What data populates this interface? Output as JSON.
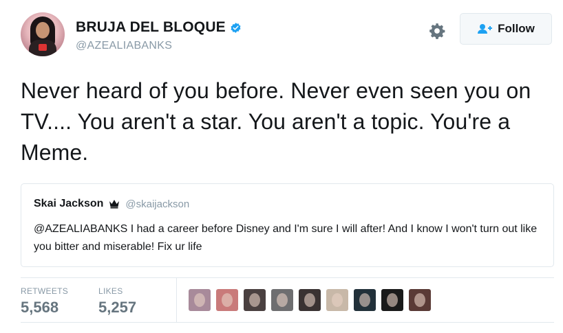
{
  "profile": {
    "display_name": "BRUJA DEL BLOQUE",
    "handle": "@AZEALIABANKS",
    "verified": true
  },
  "actions": {
    "settings_icon": "gear-icon",
    "follow_label": "Follow",
    "follow_icon": "add-user-icon"
  },
  "tweet": {
    "text": "Never heard of you before. Never even seen you on TV.... You aren't a star. You aren't a topic. You're a Meme."
  },
  "quoted_tweet": {
    "name": "Skai Jackson",
    "badge_icon": "crown-icon",
    "handle": "@skaijackson",
    "text": "@AZEALIABANKS I had a career before Disney and I'm sure I will after! And I know I won't turn out like you bitter and miserable! Fix ur life"
  },
  "stats": {
    "retweets_label": "RETWEETS",
    "retweets_value": "5,568",
    "likes_label": "LIKES",
    "likes_value": "5,257"
  },
  "likers": [
    {
      "name": "liker-avatar-1",
      "color": "#a88a9a"
    },
    {
      "name": "liker-avatar-2",
      "color": "#c97a7a"
    },
    {
      "name": "liker-avatar-3",
      "color": "#4a4040"
    },
    {
      "name": "liker-avatar-4",
      "color": "#6e6e70"
    },
    {
      "name": "liker-avatar-5",
      "color": "#3a3232"
    },
    {
      "name": "liker-avatar-6",
      "color": "#c8b8a8"
    },
    {
      "name": "liker-avatar-7",
      "color": "#22313a"
    },
    {
      "name": "liker-avatar-8",
      "color": "#1a1a1a"
    },
    {
      "name": "liker-avatar-9",
      "color": "#5a3a36"
    }
  ],
  "colors": {
    "text": "#14171a",
    "secondary": "#8899a6",
    "verified": "#1da1f2",
    "border": "#e1e8ed"
  }
}
